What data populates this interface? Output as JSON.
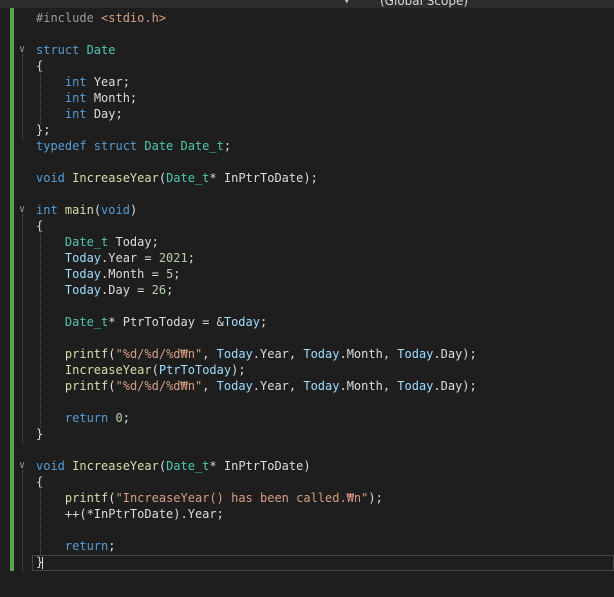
{
  "toolbar": {
    "scope": "(Global Scope)"
  },
  "code_lines": [
    {
      "fold": "",
      "tokens": [
        {
          "t": "#include ",
          "c": "pp"
        },
        {
          "t": "<stdio.h>",
          "c": "str"
        }
      ]
    },
    {
      "fold": "",
      "tokens": []
    },
    {
      "fold": "∨",
      "tokens": [
        {
          "t": "struct ",
          "c": "kw"
        },
        {
          "t": "Date",
          "c": "ty"
        }
      ]
    },
    {
      "fold": "",
      "tokens": [
        {
          "t": "{",
          "c": "tx"
        }
      ]
    },
    {
      "fold": "",
      "tokens": [
        {
          "t": "    ",
          "c": "tx"
        },
        {
          "t": "int ",
          "c": "kw"
        },
        {
          "t": "Year;",
          "c": "tx"
        }
      ]
    },
    {
      "fold": "",
      "tokens": [
        {
          "t": "    ",
          "c": "tx"
        },
        {
          "t": "int ",
          "c": "kw"
        },
        {
          "t": "Month;",
          "c": "tx"
        }
      ]
    },
    {
      "fold": "",
      "tokens": [
        {
          "t": "    ",
          "c": "tx"
        },
        {
          "t": "int ",
          "c": "kw"
        },
        {
          "t": "Day;",
          "c": "tx"
        }
      ]
    },
    {
      "fold": "",
      "tokens": [
        {
          "t": "};",
          "c": "tx"
        }
      ]
    },
    {
      "fold": "",
      "tokens": [
        {
          "t": "typedef ",
          "c": "kw"
        },
        {
          "t": "struct ",
          "c": "kw"
        },
        {
          "t": "Date ",
          "c": "ty"
        },
        {
          "t": "Date_t",
          "c": "ty"
        },
        {
          "t": ";",
          "c": "tx"
        }
      ]
    },
    {
      "fold": "",
      "tokens": []
    },
    {
      "fold": "",
      "tokens": [
        {
          "t": "void ",
          "c": "kw"
        },
        {
          "t": "IncreaseYear",
          "c": "fn"
        },
        {
          "t": "(",
          "c": "tx"
        },
        {
          "t": "Date_t",
          "c": "ty"
        },
        {
          "t": "* InPtrToDate);",
          "c": "tx"
        }
      ]
    },
    {
      "fold": "",
      "tokens": []
    },
    {
      "fold": "∨",
      "tokens": [
        {
          "t": "int ",
          "c": "kw"
        },
        {
          "t": "main",
          "c": "fn"
        },
        {
          "t": "(",
          "c": "tx"
        },
        {
          "t": "void",
          "c": "kw"
        },
        {
          "t": ")",
          "c": "tx"
        }
      ]
    },
    {
      "fold": "",
      "tokens": [
        {
          "t": "{",
          "c": "tx"
        }
      ]
    },
    {
      "fold": "",
      "tokens": [
        {
          "t": "    ",
          "c": "tx"
        },
        {
          "t": "Date_t ",
          "c": "ty"
        },
        {
          "t": "Today;",
          "c": "tx"
        }
      ]
    },
    {
      "fold": "",
      "tokens": [
        {
          "t": "    ",
          "c": "tx"
        },
        {
          "t": "Today",
          "c": "var"
        },
        {
          "t": ".Year = ",
          "c": "tx"
        },
        {
          "t": "2021",
          "c": "num"
        },
        {
          "t": ";",
          "c": "tx"
        }
      ]
    },
    {
      "fold": "",
      "tokens": [
        {
          "t": "    ",
          "c": "tx"
        },
        {
          "t": "Today",
          "c": "var"
        },
        {
          "t": ".Month = ",
          "c": "tx"
        },
        {
          "t": "5",
          "c": "num"
        },
        {
          "t": ";",
          "c": "tx"
        }
      ]
    },
    {
      "fold": "",
      "tokens": [
        {
          "t": "    ",
          "c": "tx"
        },
        {
          "t": "Today",
          "c": "var"
        },
        {
          "t": ".Day = ",
          "c": "tx"
        },
        {
          "t": "26",
          "c": "num"
        },
        {
          "t": ";",
          "c": "tx"
        }
      ]
    },
    {
      "fold": "",
      "tokens": []
    },
    {
      "fold": "",
      "tokens": [
        {
          "t": "    ",
          "c": "tx"
        },
        {
          "t": "Date_t",
          "c": "ty"
        },
        {
          "t": "* PtrToToday = &",
          "c": "tx"
        },
        {
          "t": "Today",
          "c": "var"
        },
        {
          "t": ";",
          "c": "tx"
        }
      ]
    },
    {
      "fold": "",
      "tokens": []
    },
    {
      "fold": "",
      "tokens": [
        {
          "t": "    ",
          "c": "tx"
        },
        {
          "t": "printf",
          "c": "fn"
        },
        {
          "t": "(",
          "c": "tx"
        },
        {
          "t": "\"%d/%d/%d₩n\"",
          "c": "str"
        },
        {
          "t": ", ",
          "c": "tx"
        },
        {
          "t": "Today",
          "c": "var"
        },
        {
          "t": ".Year, ",
          "c": "tx"
        },
        {
          "t": "Today",
          "c": "var"
        },
        {
          "t": ".Month, ",
          "c": "tx"
        },
        {
          "t": "Today",
          "c": "var"
        },
        {
          "t": ".Day);",
          "c": "tx"
        }
      ]
    },
    {
      "fold": "",
      "tokens": [
        {
          "t": "    ",
          "c": "tx"
        },
        {
          "t": "IncreaseYear",
          "c": "fn"
        },
        {
          "t": "(",
          "c": "tx"
        },
        {
          "t": "PtrToToday",
          "c": "var"
        },
        {
          "t": ");",
          "c": "tx"
        }
      ]
    },
    {
      "fold": "",
      "tokens": [
        {
          "t": "    ",
          "c": "tx"
        },
        {
          "t": "printf",
          "c": "fn"
        },
        {
          "t": "(",
          "c": "tx"
        },
        {
          "t": "\"%d/%d/%d₩n\"",
          "c": "str"
        },
        {
          "t": ", ",
          "c": "tx"
        },
        {
          "t": "Today",
          "c": "var"
        },
        {
          "t": ".Year, ",
          "c": "tx"
        },
        {
          "t": "Today",
          "c": "var"
        },
        {
          "t": ".Month, ",
          "c": "tx"
        },
        {
          "t": "Today",
          "c": "var"
        },
        {
          "t": ".Day);",
          "c": "tx"
        }
      ]
    },
    {
      "fold": "",
      "tokens": []
    },
    {
      "fold": "",
      "tokens": [
        {
          "t": "    ",
          "c": "tx"
        },
        {
          "t": "return ",
          "c": "kw"
        },
        {
          "t": "0",
          "c": "num"
        },
        {
          "t": ";",
          "c": "tx"
        }
      ]
    },
    {
      "fold": "",
      "tokens": [
        {
          "t": "}",
          "c": "tx"
        }
      ]
    },
    {
      "fold": "",
      "tokens": []
    },
    {
      "fold": "∨",
      "tokens": [
        {
          "t": "void ",
          "c": "kw"
        },
        {
          "t": "IncreaseYear",
          "c": "fn"
        },
        {
          "t": "(",
          "c": "tx"
        },
        {
          "t": "Date_t",
          "c": "ty"
        },
        {
          "t": "* InPtrToDate)",
          "c": "tx"
        }
      ]
    },
    {
      "fold": "",
      "tokens": [
        {
          "t": "{",
          "c": "tx"
        }
      ]
    },
    {
      "fold": "",
      "tokens": [
        {
          "t": "    ",
          "c": "tx"
        },
        {
          "t": "printf",
          "c": "fn"
        },
        {
          "t": "(",
          "c": "tx"
        },
        {
          "t": "\"IncreaseYear() has been called.₩n\"",
          "c": "str"
        },
        {
          "t": ");",
          "c": "tx"
        }
      ]
    },
    {
      "fold": "",
      "tokens": [
        {
          "t": "    ++(*InPtrToDate).Year;",
          "c": "tx"
        }
      ]
    },
    {
      "fold": "",
      "tokens": []
    },
    {
      "fold": "",
      "tokens": [
        {
          "t": "    ",
          "c": "tx"
        },
        {
          "t": "return",
          "c": "kw"
        },
        {
          "t": ";",
          "c": "tx"
        }
      ]
    },
    {
      "fold": "",
      "tokens": [
        {
          "t": "}",
          "c": "tx"
        }
      ]
    }
  ]
}
